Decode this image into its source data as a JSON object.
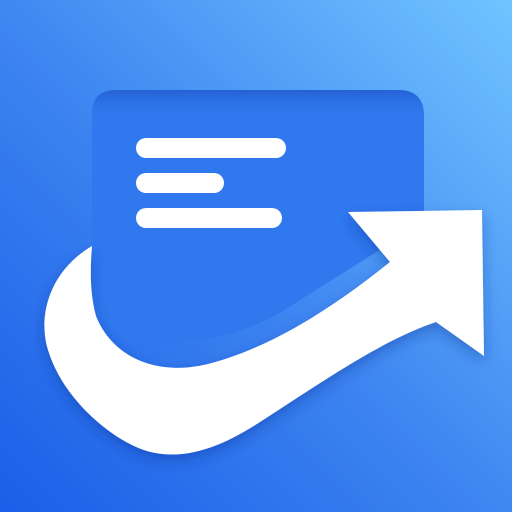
{
  "icon": {
    "semantic": "document-share-arrow-icon",
    "colors": {
      "background_start": "#1a5fe8",
      "background_end": "#70c4ff",
      "document_body": "#2f78ee",
      "document_shadow": "#1d4fbe",
      "text_lines": "#ffffff",
      "arrow": "#ffffff"
    }
  }
}
